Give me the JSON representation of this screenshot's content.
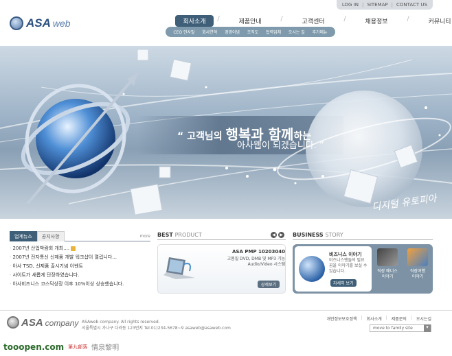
{
  "top_links": [
    "LOG IN",
    "SITEMAP",
    "CONTACT US"
  ],
  "logo": {
    "brand": "ASA",
    "suffix": "web"
  },
  "nav": {
    "items": [
      "회사소개",
      "제품안내",
      "고객센터",
      "채용정보",
      "커뮤니티"
    ],
    "active_index": 0
  },
  "subnav": [
    "CEO 인사말",
    "회사연혁",
    "경영이념",
    "조직도",
    "협력업체",
    "오시는 길",
    "추가메뉴"
  ],
  "banner": {
    "quote_line1_pre": "고객님의",
    "quote_highlight": "행복과 함께",
    "quote_line1_post": "하는",
    "quote_line2": "아사웹이 되겠습니다.",
    "signature": "디지털 유토피아"
  },
  "news": {
    "tabs": [
      "업계뉴스",
      "공지사항"
    ],
    "active_tab": 0,
    "more": "more",
    "items": [
      "2007년 산업박람회 개최....",
      "2007년 전자통신 신제품 개발 워크샵이 열립니다...",
      "아사 TSD, 신제품 출시기념 이벤트",
      "사이트가 새롭게 단장하였습니다.",
      "아사비즈니스 코스닥상장 이후 10%이상 상승했습니다."
    ]
  },
  "best_product": {
    "title_bold": "BEST",
    "title_rest": "PRODUCT",
    "name": "ASA PMP 10203040",
    "desc": "고품질 DVD, DMB 및 MP3 기능\nAudio/Video 시스템",
    "button": "상세보기"
  },
  "business": {
    "title_bold": "BUSINESS",
    "title_rest": "STORY",
    "story_title": "비즈니스 이야기",
    "story_desc": "비즈니스맨들의 필요 꿈을 이야기를 보실 수 있습니다.",
    "story_button": "자세히 보기",
    "item1": "직장 매너스\n이야기",
    "item2": "직장여행\n이야기"
  },
  "footer": {
    "logo_brand": "ASA",
    "logo_suffix": "company",
    "copyright": "ASAweb company. All rights reserved.",
    "address": "서울특별시 가나구 다라동 123번지 Tel.01)234-5678~9 asaweb@asaweb.com",
    "links": [
      "개인정보보호정책",
      "회사소개",
      "제품문의",
      "오시는길"
    ],
    "family_select": "move to family site"
  },
  "watermark": {
    "brand": "tooopen.com",
    "cn1": "第九部落",
    "cn2": "情泉黎明"
  },
  "colors": {
    "accent": "#3f5f78",
    "subnav": "#7e9aac",
    "brand": "#2c4f7f"
  }
}
